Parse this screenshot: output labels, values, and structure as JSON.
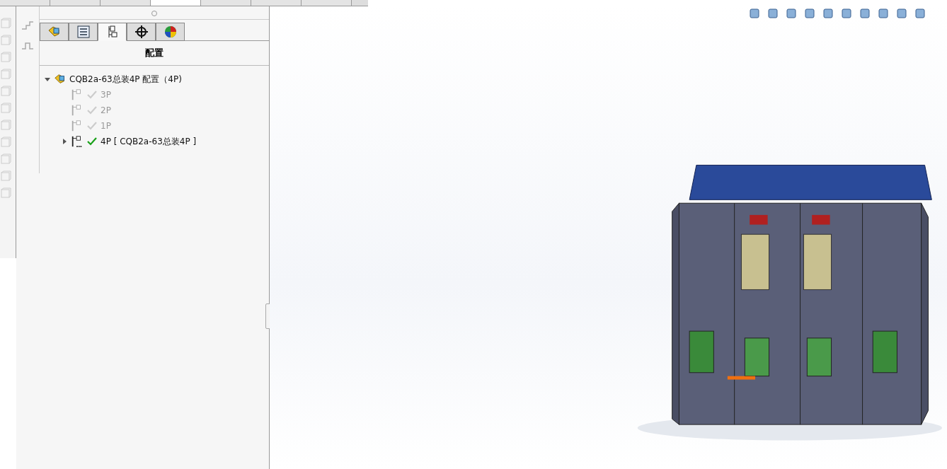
{
  "command_tabs": [
    {
      "selected": false
    },
    {
      "selected": false
    },
    {
      "selected": false
    },
    {
      "selected": true
    },
    {
      "selected": false
    },
    {
      "selected": false
    },
    {
      "selected": false
    }
  ],
  "manager_tabs": [
    {
      "kind": "feature",
      "selected": false
    },
    {
      "kind": "property",
      "selected": false
    },
    {
      "kind": "configuration",
      "selected": true
    },
    {
      "kind": "dimxpert",
      "selected": false
    },
    {
      "kind": "display",
      "selected": false
    }
  ],
  "panel": {
    "title": "配置"
  },
  "tree": {
    "label": "CQB2a-63总装4P 配置（4P)",
    "expanded": true,
    "children": [
      {
        "label": "3P",
        "active": false,
        "has_children": false
      },
      {
        "label": "2P",
        "active": false,
        "has_children": false
      },
      {
        "label": "1P",
        "active": false,
        "has_children": false
      },
      {
        "label": "4P [ CQB2a-63总装4P ]",
        "active": true,
        "expanded": false,
        "has_children": true
      }
    ]
  }
}
